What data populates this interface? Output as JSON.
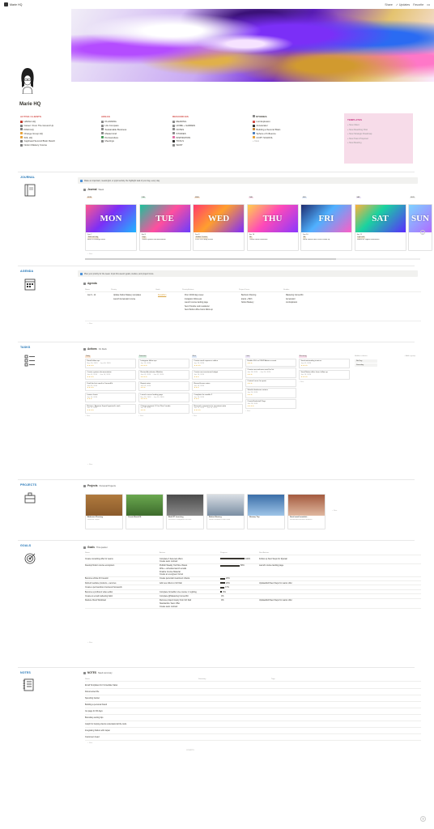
{
  "topbar": {
    "workspace": "Marie HQ",
    "share": "Share",
    "updates": "✓ Updates",
    "favorite": "Favorite",
    "more": "•••"
  },
  "page": {
    "title": "Marie HQ"
  },
  "columns": {
    "active_clients": {
      "title": "ACTIVE CLIENTS",
      "items": [
        "HAMLA HQ",
        "Career: From The Ground Up",
        "KIMO HQ",
        "Change Group HQ",
        "SOL HQ",
        "Jugshead Second Brain Rewrit",
        "Notion Mastery Course"
      ]
    },
    "areas": {
      "title": "AREAS",
      "items": [
        "PLANNING",
        "Life Compass",
        "Sustainable Business",
        "Mastermind",
        "Permaculture",
        "Meetings"
      ]
    },
    "resources": {
      "title": "RESOURCES",
      "items": [
        "READING",
        "HOME + GARDEN",
        "NOTES",
        "STUDIES",
        "INSPIRATION",
        "TOOLS",
        "WANT"
      ]
    },
    "studies": {
      "title": "STUDIES",
      "items": [
        "List Explosion",
        "Accelerator",
        "Building a Second Brain",
        "Sphere of Influence",
        "COPY SCHOOL"
      ],
      "new": "+ New"
    }
  },
  "templates": {
    "title": "TEMPLATES",
    "items": [
      "New Client",
      "New Reaching Post",
      "New Strategic Roadmap",
      "New Team Proposal",
      "New Meeting"
    ]
  },
  "journal": {
    "label": "JOURNAL",
    "callout": "Make an important, meaningful, or joyful activity the highlight task of your day, every day.",
    "db_title": "Journal",
    "view": "Week",
    "days": [
      {
        "tag": "MON",
        "word": "MON",
        "date": "Jan 7",
        "pill": "Walk with dog",
        "note": "Brett 20 Writing review"
      },
      {
        "tag": "TUE",
        "word": "TUE",
        "date": "Jan 8",
        "pill": "Yoga",
        "note": "Create systems documentation"
      },
      {
        "tag": "WED",
        "word": "WED",
        "date": "Jan 9",
        "pill": "Hobbie Creative",
        "note": "2100 2019 blog review"
      },
      {
        "tag": "THU",
        "word": "THU",
        "date": "Jan 10",
        "pill": "Art",
        "note": "Create email newsletter"
      },
      {
        "tag": "FRI",
        "word": "FRI",
        "date": "Jan 10",
        "pill": "Art",
        "note": "Send Notion office hours follow up"
      },
      {
        "tag": "SAT",
        "word": "SAT",
        "date": "Jan 11",
        "pill": "Light walk",
        "note": "outline for 'digital minimalism'"
      },
      {
        "tag": "SUN",
        "word": "SUN",
        "date": "",
        "pill": "",
        "note": ""
      }
    ],
    "new": "+ New"
  },
  "agenda": {
    "label": "AGENDA",
    "callout": "Plan your priority for the week. Input this week's goals, studies, and project focus.",
    "db_title": "Agenda",
    "headers": [
      "Name",
      "Priority",
      "Goals",
      "Priority Actions",
      "Project Focus",
      "Studies"
    ],
    "row": {
      "name": "Jan 6 - 12",
      "priority": [
        "Update Notion Mastery templates",
        "Launch Accelerator course"
      ],
      "goals": "Decathlon",
      "actions": [
        "Post: 2019 blog review",
        "Instagram follow-ups",
        "Launch course landing page",
        "Send Youtube ceilo newsletter",
        "Send Notion office hours follow up"
      ],
      "projects": [
        "Bedroom Flooring",
        "Ipanis + Birth",
        "Notion Mastery"
      ],
      "studies": [
        "Mastering ConvertKit",
        "Accelerator",
        "List Explosion"
      ]
    },
    "new": "+ New"
  },
  "tasks": {
    "label": "TASKS",
    "db_title": "Actions",
    "view": "On Deck",
    "columns": [
      {
        "name": "Today",
        "cards": [
          {
            "title": "Email follow ups",
            "date": "Nov 26, 2019 → Jan 03, 2020",
            "stars": "★★★★"
          },
          {
            "title": "Create systems documentation",
            "date": "Jan 03, 2020 → Jan 16, 2020",
            "stars": "★★★★"
          },
          {
            "title": "Draft the first email in ConvertKit",
            "date": "Jan 03, 2020",
            "stars": "★★★★"
          },
          {
            "title": "Invoice Ivanis",
            "date": "Jan 10, 2020",
            "stars": "★★★"
          },
          {
            "title": "Review + Approve SuperOrganized's work",
            "date": "Jan 11, 2020",
            "stars": "★★★★"
          }
        ]
      },
      {
        "name": "Tomorrow",
        "cards": [
          {
            "title": "Instagram follow ups",
            "date": "Jan 13, 2020",
            "stars": "★★★★"
          },
          {
            "title": "Review Accelerator Modules",
            "date": "Jan 03, 2020 → Jan 31, 2020",
            "stars": "★★★★"
          },
          {
            "title": "Report notes",
            "date": "Jan 03, 2020",
            "stars": "★★★"
          },
          {
            "title": "Launch course landing page",
            "date": "Nov 26, 2019 → Jan 15, 2020",
            "stars": "★★★★"
          },
          {
            "title": "Change payment CC for Plan Canada",
            "date": "Jan 15, 2020",
            "stars": "★★★"
          }
        ]
      },
      {
        "name": "Next",
        "cards": [
          {
            "title": "Create email sequence outline",
            "date": "Jan 15, 2020",
            "stars": "★★★★"
          },
          {
            "title": "Create new investment budget",
            "date": "Jan 16, 2020",
            "stars": "★★★"
          },
          {
            "title": "Record lesson notes",
            "date": "Jan 16, 2020",
            "stars": "★★★"
          },
          {
            "title": "Complete the module 2",
            "date": "Jan 16, 2020",
            "stars": "★★★"
          },
          {
            "title": "Research companies for investment plan",
            "date": "Jan 20, 2020 → Jan 24, 2020",
            "stars": "★★★★"
          }
        ]
      },
      {
        "name": "Later",
        "cards": [
          {
            "title": "Enable SSL on FFHP Admin account",
            "date": "",
            "stars": "★★★"
          },
          {
            "title": "Create new welcome email for list",
            "date": "Jan 18, 2020 → Jan 20, 2020",
            "stars": "★★★"
          },
          {
            "title": "Contact house for quote",
            "date": "",
            "stars": "★★★"
          },
          {
            "title": "Shortlist bedroom curtains",
            "date": "Jan 20, 2020",
            "stars": "★★★"
          },
          {
            "title": "Create Bookshelf Page",
            "date": "Jan 28, 2020",
            "stars": "★★★★"
          }
        ]
      },
      {
        "name": "Recurring",
        "cards": [
          {
            "title": "Send outstanding invoices",
            "date": "Jan 02, 2020",
            "stars": "★★★★"
          },
          {
            "title": "Send Notion office hours follow up",
            "date": "Jan 10, 2020",
            "stars": "★★★★"
          }
        ]
      }
    ],
    "hidden": {
      "label": "Hidden columns",
      "item": "No Day",
      "value": "Someday",
      "add": "+ Add a group"
    },
    "new": "+ New"
  },
  "projects": {
    "label": "PROJECTS",
    "db_title": "Projects",
    "view": "Personal Projects",
    "cards": [
      {
        "title": "Bedroom Flooring",
        "sub": "Remove carpet"
      },
      {
        "title": "Create MariaOS",
        "sub": ""
      },
      {
        "title": "Buki RT Investing",
        "sub": "Research companies for inve"
      },
      {
        "title": "Notion Mastery",
        "sub": "Notion feedback from Intuit"
      },
      {
        "title": "Norway Trip",
        "sub": ""
      },
      {
        "title": "Send email newslett...",
        "sub": "Review Accelerator Modules"
      }
    ],
    "new": "+ New"
  },
  "goals": {
    "label": "GOALS",
    "db_title": "Goals",
    "view": "This quarter",
    "headers": [
      "Name",
      "Actions",
      "Progress",
      "Next Actions"
    ],
    "rows": [
      {
        "name": "Create consulting offer for teams",
        "actions": [
          "Complete 3 beta test offers",
          "Create team contract"
        ],
        "progress": 100,
        "next": "Follow up Next Steps for Ryanair"
      },
      {
        "name": "Develop Notion course ecosystem",
        "actions": [
          "Publish Weekly YouTube Videos",
          "Write + schedule launch emails",
          "Finalize Course Material",
          "Create an evergreen funnel"
        ],
        "progress": 80,
        "next": "Launch course landing page"
      },
      {
        "name": "Become a Rule #1 Investor",
        "actions": [
          "Create personal investment criteria"
        ],
        "progress": 20,
        "next": ""
      },
      {
        "name": "Refresh website products + services",
        "actions": [
          "Add new offers to Ck! Dali"
        ],
        "progress": 20,
        "next": "Update/Edit New Steps for teams offer"
      },
      {
        "name": "Create a permaculture business framework",
        "actions": [],
        "progress": 17,
        "next": ""
      },
      {
        "name": "Become a proficient video editor",
        "actions": [
          "Complete Crowdfun Live course 1: Lighting"
        ],
        "progress": 8,
        "next": ""
      },
      {
        "name": "Create an email marketing habit",
        "actions": [
          "Complete @Mastering ConvertKit"
        ],
        "progress": 0,
        "next": ""
      },
      {
        "name": "Reduce Client Workload",
        "actions": [
          "Remove project inquiry from Ck! Dali",
          "Standardize Team Offer",
          "Create team contract"
        ],
        "progress": 0,
        "next": "Update/Edit New Steps for teams offer"
      }
    ],
    "new": "+ New"
  },
  "notes": {
    "label": "NOTES",
    "db_title": "NOTES",
    "view": "Need summary",
    "headers": [
      "Name",
      "Summary",
      "Tags"
    ],
    "rows": [
      "Email Templates For Immediate Sales",
      "Documented life",
      "Spending tracker",
      "Building a personal brand",
      "Go page for 30 days",
      "Boundary-setting tips",
      "Graph for helping clients understand all the tools",
      "Integrating Notion with zapier",
      "Customers head"
    ],
    "new": "+ New",
    "count": "COUNT 9"
  },
  "help": "?"
}
